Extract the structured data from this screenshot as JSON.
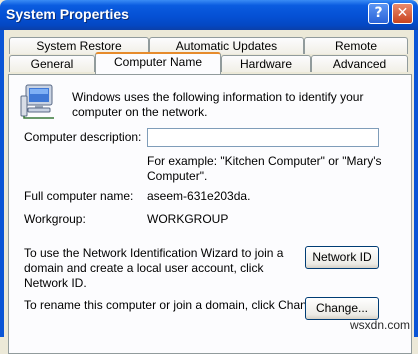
{
  "window": {
    "title": "System Properties",
    "help_glyph": "?",
    "close_glyph": "✕"
  },
  "tabs": {
    "row1": [
      "System Restore",
      "Automatic Updates",
      "Remote"
    ],
    "row2": [
      "General",
      "Computer Name",
      "Hardware",
      "Advanced"
    ],
    "active": "Computer Name"
  },
  "content": {
    "intro": "Windows uses the following information to identify your computer on the network.",
    "description_label": "Computer description:",
    "description_value": "",
    "example": "For example: \"Kitchen Computer\" or \"Mary's Computer\".",
    "full_name_label": "Full computer name:",
    "full_name_value": "aseem-631e203da.",
    "workgroup_label": "Workgroup:",
    "workgroup_value": "WORKGROUP",
    "wizard_text": "To use the Network Identification Wizard to join a domain and create a local user account, click Network ID.",
    "network_id_button": "Network ID",
    "rename_text": "To rename this computer or join a domain, click Change.",
    "change_button": "Change..."
  },
  "icons": {
    "computer": "computer-network-icon"
  },
  "watermark": "wsxdn.com",
  "colors": {
    "titlebar": "#0550d4",
    "tab_highlight": "#e68b2c",
    "panel": "#fcfcfe"
  }
}
